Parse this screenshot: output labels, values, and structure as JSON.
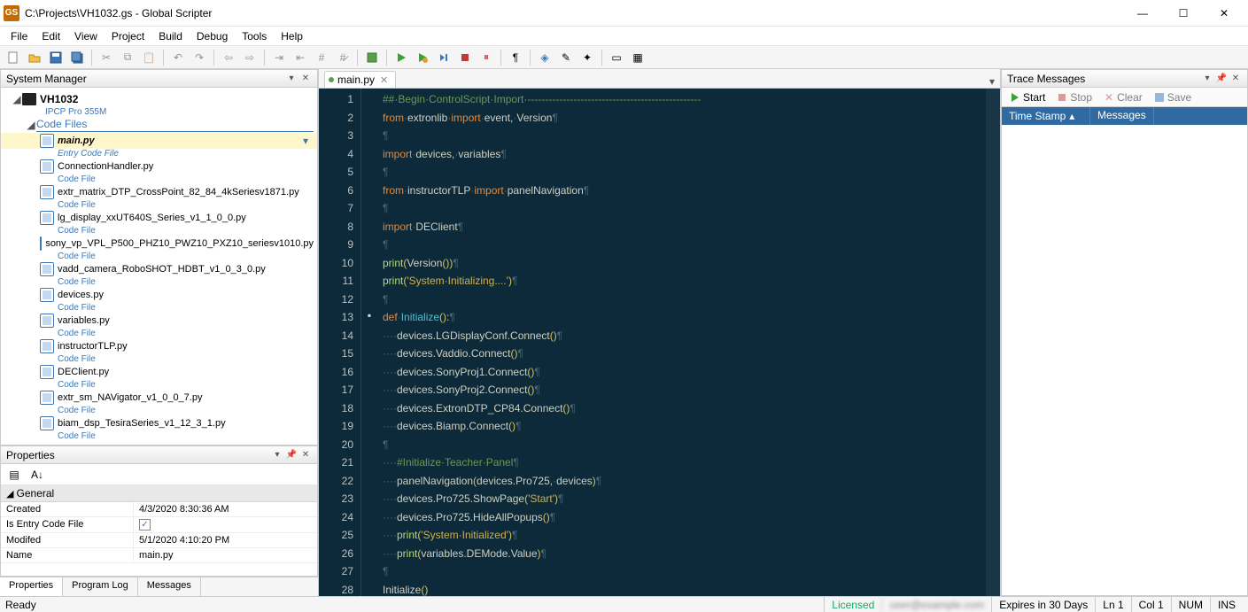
{
  "window": {
    "app_badge": "GS",
    "title": "C:\\Projects\\VH1032.gs - Global Scripter",
    "min": "—",
    "max": "☐",
    "close": "✕"
  },
  "menu": [
    "File",
    "Edit",
    "View",
    "Project",
    "Build",
    "Debug",
    "Tools",
    "Help"
  ],
  "panels": {
    "system_manager": "System Manager",
    "properties": "Properties",
    "trace": "Trace Messages"
  },
  "tree": {
    "device": "VH1032",
    "device_model": "IPCP Pro 355M",
    "code_files": "Code Files",
    "files": [
      {
        "name": "main.py",
        "sub": "Entry Code File",
        "selected": true,
        "bold": true
      },
      {
        "name": "ConnectionHandler.py",
        "sub": "Code File"
      },
      {
        "name": "extr_matrix_DTP_CrossPoint_82_84_4kSeriesv1871.py",
        "sub": "Code File"
      },
      {
        "name": "lg_display_xxUT640S_Series_v1_1_0_0.py",
        "sub": "Code File"
      },
      {
        "name": "sony_vp_VPL_P500_PHZ10_PWZ10_PXZ10_seriesv1010.py",
        "sub": "Code File"
      },
      {
        "name": "vadd_camera_RoboSHOT_HDBT_v1_0_3_0.py",
        "sub": "Code File"
      },
      {
        "name": "devices.py",
        "sub": "Code File"
      },
      {
        "name": "variables.py",
        "sub": "Code File"
      },
      {
        "name": "instructorTLP.py",
        "sub": "Code File"
      },
      {
        "name": "DEClient.py",
        "sub": "Code File"
      },
      {
        "name": "extr_sm_NAVigator_v1_0_0_7.py",
        "sub": "Code File"
      },
      {
        "name": "biam_dsp_TesiraSeries_v1_12_3_1.py",
        "sub": "Code File"
      }
    ]
  },
  "properties": {
    "section": "General",
    "rows": [
      {
        "name": "Created",
        "value": "4/3/2020 8:30:36 AM"
      },
      {
        "name": "Is Entry Code File",
        "value": "__check__"
      },
      {
        "name": "Modifed",
        "value": "5/1/2020 4:10:20 PM"
      },
      {
        "name": "Name",
        "value": "main.py"
      }
    ]
  },
  "bottom_tabs": [
    "Properties",
    "Program Log",
    "Messages"
  ],
  "editor": {
    "tab": "main.py",
    "lines": [
      {
        "n": 1,
        "html": "<span class='tk-comment'>##·Begin·ControlScript·Import·-------------------------------------------------</span>"
      },
      {
        "n": 2,
        "html": "<span class='tk-kw'>from</span><span class='ws'>·</span>extronlib<span class='ws'>·</span><span class='tk-kw'>import</span><span class='ws'>·</span>event,<span class='ws'>·</span>Version<span class='ws'>¶</span>"
      },
      {
        "n": 3,
        "html": "<span class='ws'>¶</span>"
      },
      {
        "n": 4,
        "html": "<span class='tk-kw'>import</span><span class='ws'>·</span>devices,<span class='ws'>·</span>variables<span class='ws'>¶</span>"
      },
      {
        "n": 5,
        "html": "<span class='ws'>¶</span>"
      },
      {
        "n": 6,
        "html": "<span class='tk-kw'>from</span><span class='ws'>·</span>instructorTLP<span class='ws'>·</span><span class='tk-kw'>import</span><span class='ws'>·</span>panelNavigation<span class='ws'>¶</span>"
      },
      {
        "n": 7,
        "html": "<span class='ws'>¶</span>"
      },
      {
        "n": 8,
        "html": "<span class='tk-kw'>import</span><span class='ws'>·</span>DEClient<span class='ws'>¶</span>"
      },
      {
        "n": 9,
        "html": "<span class='ws'>¶</span>"
      },
      {
        "n": 10,
        "html": "<span class='tk-func'>print</span><span class='tk-par'>(</span>Version<span class='tk-par'>()</span><span class='tk-par'>)</span><span class='ws'>¶</span>"
      },
      {
        "n": 11,
        "html": "<span class='tk-func'>print</span><span class='tk-par'>(</span><span class='tk-str'>'System·Initializing....'</span><span class='tk-par'>)</span><span class='ws'>¶</span>"
      },
      {
        "n": 12,
        "html": "<span class='ws'>¶</span>"
      },
      {
        "n": 13,
        "html": "<span class='tk-kw'>def</span><span class='ws'>·</span><span class='tk-name'>Initialize</span><span class='tk-par'>()</span>:<span class='ws'>¶</span>",
        "fold": "▪"
      },
      {
        "n": 14,
        "html": "<span class='ws'>····</span>devices.LGDisplayConf.Connect<span class='tk-par'>()</span><span class='ws'>¶</span>"
      },
      {
        "n": 15,
        "html": "<span class='ws'>····</span>devices.Vaddio.Connect<span class='tk-par'>()</span><span class='ws'>¶</span>"
      },
      {
        "n": 16,
        "html": "<span class='ws'>····</span>devices.SonyProj1.Connect<span class='tk-par'>()</span><span class='ws'>¶</span>"
      },
      {
        "n": 17,
        "html": "<span class='ws'>····</span>devices.SonyProj2.Connect<span class='tk-par'>()</span><span class='ws'>¶</span>"
      },
      {
        "n": 18,
        "html": "<span class='ws'>····</span>devices.ExtronDTP_CP84.Connect<span class='tk-par'>()</span><span class='ws'>¶</span>"
      },
      {
        "n": 19,
        "html": "<span class='ws'>····</span>devices.Biamp.Connect<span class='tk-par'>()</span><span class='ws'>¶</span>"
      },
      {
        "n": 20,
        "html": "<span class='ws'>¶</span>"
      },
      {
        "n": 21,
        "html": "<span class='ws'>····</span><span class='tk-comment'>#Initialize·Teacher·Panel</span><span class='ws'>¶</span>"
      },
      {
        "n": 22,
        "html": "<span class='ws'>····</span>panelNavigation<span class='tk-par'>(</span>devices.Pro725,<span class='ws'>·</span>devices<span class='tk-par'>)</span><span class='ws'>¶</span>"
      },
      {
        "n": 23,
        "html": "<span class='ws'>····</span>devices.Pro725.ShowPage<span class='tk-par'>(</span><span class='tk-str'>'Start'</span><span class='tk-par'>)</span><span class='ws'>¶</span>"
      },
      {
        "n": 24,
        "html": "<span class='ws'>····</span>devices.Pro725.HideAllPopups<span class='tk-par'>()</span><span class='ws'>¶</span>"
      },
      {
        "n": 25,
        "html": "<span class='ws'>····</span><span class='tk-func'>print</span><span class='tk-par'>(</span><span class='tk-str'>'System·Initialized'</span><span class='tk-par'>)</span><span class='ws'>¶</span>"
      },
      {
        "n": 26,
        "html": "<span class='ws'>····</span><span class='tk-func'>print</span><span class='tk-par'>(</span>variables.DEMode.Value<span class='tk-par'>)</span><span class='ws'>¶</span>"
      },
      {
        "n": 27,
        "html": "<span class='ws'>¶</span>"
      },
      {
        "n": 28,
        "html": "Initialize<span class='tk-par'>()</span>"
      }
    ]
  },
  "trace": {
    "start": "Start",
    "stop": "Stop",
    "clear": "Clear",
    "save": "Save",
    "col1": "Time Stamp",
    "col2": "Messages"
  },
  "status": {
    "ready": "Ready",
    "license": "Licensed",
    "expires": "Expires in 30 Days",
    "ln": "Ln 1",
    "col": "Col 1",
    "num": "NUM",
    "ins": "INS"
  }
}
